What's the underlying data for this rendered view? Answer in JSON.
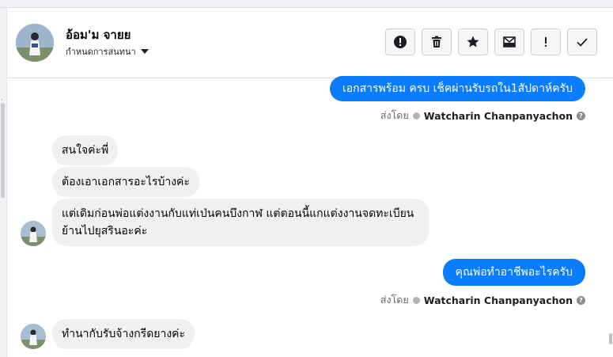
{
  "header": {
    "contact_name": "อ้อม'ม จายย",
    "settings_label": "กำหนดการสนทนา",
    "tools": [
      {
        "name": "report-icon"
      },
      {
        "name": "trash-icon"
      },
      {
        "name": "star-icon"
      },
      {
        "name": "mark-unread-icon"
      },
      {
        "name": "important-icon"
      },
      {
        "name": "done-icon"
      }
    ]
  },
  "messages": [
    {
      "dir": "out",
      "text": "เอกสารพร้อม ครบ เช็คผ่านรับรถใน1สัปดาห์ครับ",
      "sent_prefix": "ส่งโดย",
      "sender": "Watcharin Chanpanyachon"
    },
    {
      "dir": "in",
      "text": "สนใจค่ะพี่"
    },
    {
      "dir": "in",
      "text": "ต้องเอาเอกสารอะไรบ้างค่ะ"
    },
    {
      "dir": "in",
      "text": "แต่เดิมก่อนพ่อแต่งงานกับแท่เป่นคนบึงกาฬ แต่ตอนนี้แกแต่งงานจดทะเบียน ย้านไปยุสรินอะค่ะ"
    },
    {
      "dir": "out",
      "text": "คุณพ่อทำอาชีพอะไรครับ",
      "sent_prefix": "ส่งโดย",
      "sender": "Watcharin Chanpanyachon"
    },
    {
      "dir": "in",
      "text": "ทำนากับรับจ้างกรีดยางค่ะ"
    }
  ],
  "colors": {
    "outgoing": "#0a7cff",
    "incoming": "#f0f0f0"
  }
}
